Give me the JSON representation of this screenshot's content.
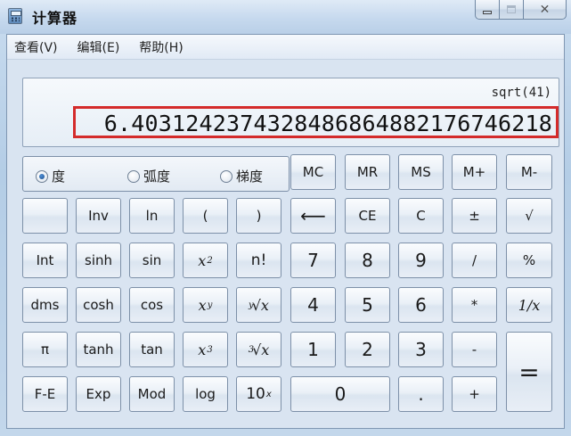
{
  "window": {
    "title": "计算器"
  },
  "menu": {
    "view": "查看(V)",
    "edit": "编辑(E)",
    "help": "帮助(H)"
  },
  "display": {
    "expression": "sqrt(41)",
    "result": "6.4031242374328486864882176746218"
  },
  "angle": {
    "degrees": "度",
    "radians": "弧度",
    "grads": "梯度",
    "selected": "度"
  },
  "memory": {
    "mc": "MC",
    "mr": "MR",
    "ms": "MS",
    "mplus": "M+",
    "mminus": "M-"
  },
  "keys": {
    "inv": "Inv",
    "ln": "ln",
    "lparen": "(",
    "rparen": ")",
    "back": "⟵",
    "ce": "CE",
    "c": "C",
    "plusminus": "±",
    "sqrt": "√",
    "int": "Int",
    "sinh": "sinh",
    "sin": "sin",
    "x2_base": "x",
    "x2_exp": "2",
    "fact": "n!",
    "d7": "7",
    "d8": "8",
    "d9": "9",
    "div": "/",
    "pct": "%",
    "dms": "dms",
    "cosh": "cosh",
    "cos": "cos",
    "xy_base": "x",
    "xy_exp": "y",
    "yroot_idx": "y",
    "yroot_sym": "√",
    "yroot_x": "x",
    "d4": "4",
    "d5": "5",
    "d6": "6",
    "mul": "*",
    "recip": "1/x",
    "pi": "π",
    "tanh": "tanh",
    "tan": "tan",
    "x3_base": "x",
    "x3_exp": "3",
    "croot_idx": "3",
    "croot_sym": "√",
    "croot_x": "x",
    "d1": "1",
    "d2": "2",
    "d3": "3",
    "sub": "-",
    "eq": "=",
    "fe": "F-E",
    "exp": "Exp",
    "mod": "Mod",
    "log": "log",
    "tenx_base": "10",
    "tenx_exp": "x",
    "d0": "0",
    "dot": ".",
    "add": "+"
  },
  "colors": {
    "highlight_border": "#d42b2b"
  }
}
